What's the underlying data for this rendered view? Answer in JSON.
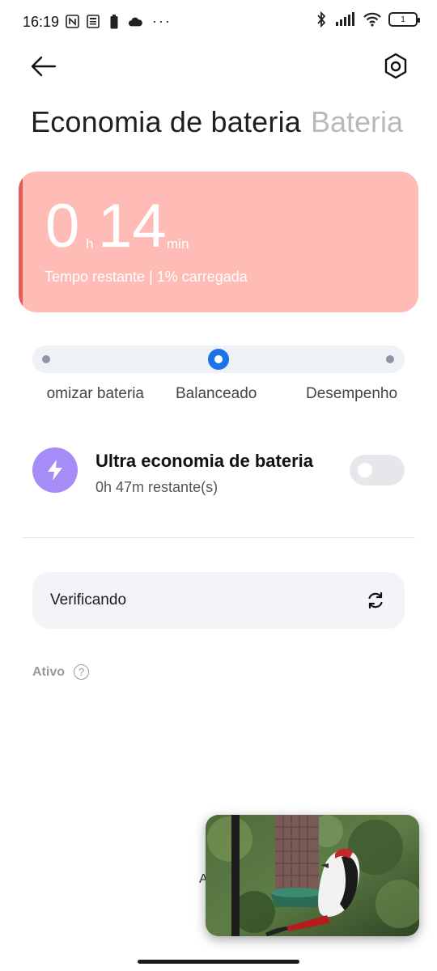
{
  "status_bar": {
    "time": "16:19",
    "battery_level": "1",
    "left_icons": [
      "nfc-icon",
      "news-icon",
      "battery-saver-icon",
      "cloud-icon",
      "more-dots-icon"
    ],
    "right_icons": [
      "bluetooth-icon",
      "signal-icon",
      "wifi-icon",
      "battery-icon"
    ],
    "more_dots": "···"
  },
  "header": {
    "back_icon": "arrow-left-icon",
    "settings_icon": "settings-hexagon-icon"
  },
  "tabs": {
    "active": "Economia de bateria",
    "inactive": "Bateria"
  },
  "battery_card": {
    "hours": "0",
    "hours_unit": "h",
    "minutes": "14",
    "minutes_unit": "min",
    "subtitle": "Tempo restante | 1% carregada",
    "background_color": "#ffbcb6",
    "stripe_color": "#e85a55"
  },
  "modes": {
    "options": [
      "Economizar bateria",
      "Balanceado",
      "Desempenho"
    ],
    "visible_first_label": "omizar bateria",
    "selected": "Balanceado",
    "accent_color": "#1a73e8"
  },
  "ultra_saver": {
    "title": "Ultra economia de bateria",
    "subtitle": "0h 47m restante(s)",
    "icon": "lightning-bolt-icon",
    "icon_color": "#a58cf6",
    "enabled": false
  },
  "verify": {
    "label": "Verificando",
    "icon": "refresh-icon"
  },
  "active_section": {
    "label": "Ativo",
    "help_icon": "?"
  },
  "hidden_text": "A",
  "pip": {
    "content": "woodpecker-on-bird-feeder-video"
  }
}
